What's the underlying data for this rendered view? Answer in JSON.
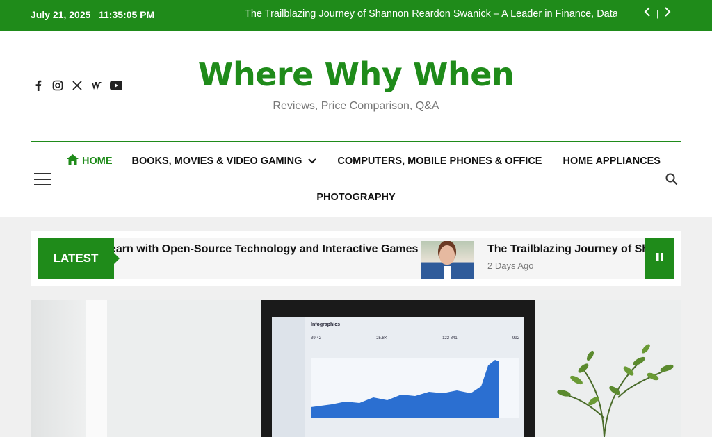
{
  "colors": {
    "accent": "#1f8b1a"
  },
  "topbar": {
    "date": "July 21, 2025",
    "time": "11:35:05 PM",
    "headline": "The Trailblazing Journey of Shannon Reardon Swanick – A Leader in Finance, Data",
    "prev_icon": "chevron-left-icon",
    "separator": "|",
    "next_icon": "chevron-right-icon"
  },
  "social": [
    "facebook-icon",
    "instagram-icon",
    "x-icon",
    "wattpad-icon",
    "youtube-icon"
  ],
  "brand": {
    "title": "Where Why When",
    "tagline": "Reviews, Price Comparison, Q&A"
  },
  "nav": {
    "items": [
      {
        "label": "HOME",
        "icon": "home-icon"
      },
      {
        "label": "BOOKS, MOVIES & VIDEO GAMING",
        "icon": "chevron-down-icon"
      },
      {
        "label": "COMPUTERS, MOBILE PHONES & OFFICE"
      },
      {
        "label": "HOME APPLIANCES"
      },
      {
        "label": "PHOTOGRAPHY"
      }
    ],
    "menu_icon": "hamburger-icon",
    "search_icon": "search-icon"
  },
  "latest": {
    "label": "LATEST",
    "items": [
      {
        "title": "earn with Open-Source Technology and Interactive Games"
      },
      {
        "title": "The Trailblazing Journey of Sha",
        "meta": "2 Days Ago"
      }
    ],
    "pause_icon": "pause-icon"
  },
  "hero": {
    "screen_title": "Infographics",
    "kpis": [
      "39.42",
      "25.8K",
      "122 841",
      "992"
    ]
  }
}
